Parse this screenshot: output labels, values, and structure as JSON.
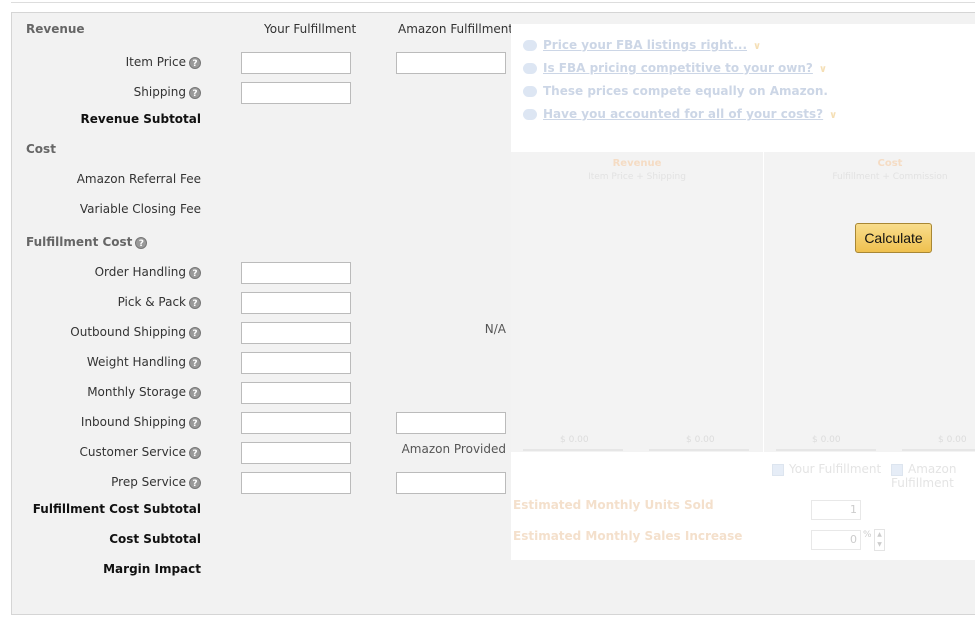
{
  "headers": {
    "revenue": "Revenue",
    "your_fulfillment": "Your Fulfillment",
    "amazon_fulfillment": "Amazon Fulfillment",
    "cost": "Cost",
    "fulfillment_cost": "Fulfillment Cost"
  },
  "rows": {
    "item_price": "Item Price",
    "shipping": "Shipping",
    "revenue_subtotal": "Revenue Subtotal",
    "referral_fee": "Amazon Referral Fee",
    "variable_closing_fee": "Variable Closing Fee",
    "order_handling": "Order Handling",
    "pick_pack": "Pick & Pack",
    "outbound_shipping": "Outbound Shipping",
    "weight_handling": "Weight Handling",
    "monthly_storage": "Monthly Storage",
    "inbound_shipping": "Inbound Shipping",
    "customer_service": "Customer Service",
    "prep_service": "Prep Service",
    "fulfillment_cost_subtotal": "Fulfillment Cost Subtotal",
    "cost_subtotal": "Cost Subtotal",
    "margin_impact": "Margin Impact"
  },
  "amazon_values": {
    "outbound_na": "N/A",
    "customer_service": "Amazon Provided"
  },
  "help_glyph": "?",
  "tips": [
    "Price your FBA listings right...",
    "Is FBA pricing competitive to your own?",
    "These prices compete equally on Amazon.",
    "Have you accounted for all of your costs?"
  ],
  "chart": {
    "revenue_title": "Revenue",
    "revenue_sub": "Item Price + Shipping",
    "cost_title": "Cost",
    "cost_sub": "Fulfillment + Commission",
    "zero": "$ 0.00"
  },
  "calculate_label": "Calculate",
  "legend": {
    "yours": "Your Fulfillment",
    "amazon": "Amazon Fulfillment"
  },
  "estimates": {
    "units_label": "Estimated Monthly Units Sold",
    "units_value": "1",
    "sales_label": "Estimated Monthly Sales Increase",
    "sales_value": "0",
    "sales_unit": "%"
  },
  "colors": {
    "button": "#f0c14b",
    "tip_link": "#ccd6e6"
  }
}
